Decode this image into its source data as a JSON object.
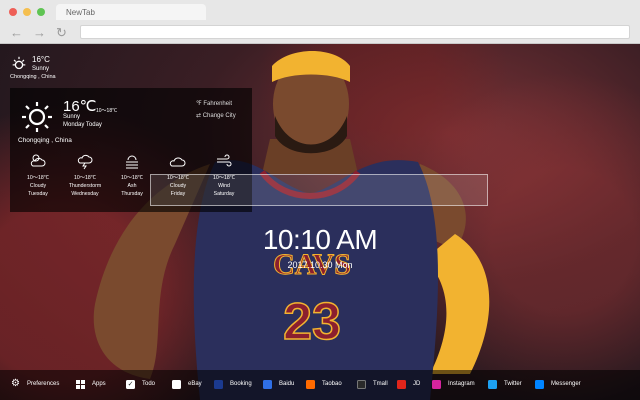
{
  "browser": {
    "tab_title": "NewTab"
  },
  "weather_small": {
    "temp": "16°C",
    "condition": "Sunny",
    "location": "Chongqing , China"
  },
  "weather_panel": {
    "temp": "16℃",
    "range": "10～18℃",
    "condition": "Sunny",
    "day": "Monday Today",
    "fahrenheit": "Fahrenheit",
    "change_city": "Change City",
    "location": "Chongqing , China",
    "forecast": [
      {
        "icon": "cloudy-icon",
        "range": "10～18℃",
        "condition": "Cloudy",
        "day": "Tuesday"
      },
      {
        "icon": "thunderstorm-icon",
        "range": "10～18℃",
        "condition": "Thunderstorm",
        "day": "Wednesday"
      },
      {
        "icon": "ash-icon",
        "range": "10～18℃",
        "condition": "Ash",
        "day": "Thursday"
      },
      {
        "icon": "cloud-icon",
        "range": "10～18℃",
        "condition": "Cloudy",
        "day": "Friday"
      },
      {
        "icon": "wind-icon",
        "range": "10～18℃",
        "condition": "Wind",
        "day": "Saturday"
      }
    ]
  },
  "clock": {
    "time": "10:10 AM",
    "date": "2017.10.30 Mon"
  },
  "bottom_bar": {
    "preferences": "Preferences",
    "apps": "Apps",
    "todo": "Todo",
    "links": [
      "eBay",
      "Booking",
      "Baidu",
      "Taobao",
      "Tmall",
      "JD",
      "Instagram",
      "Twitter",
      "Messenger"
    ]
  },
  "colors": {
    "traffic_red": "#ee5f57",
    "traffic_yellow": "#f5bf4f",
    "traffic_green": "#5fc453",
    "jersey_navy": "#2b2f5c",
    "jersey_wine": "#8b1f2e",
    "jersey_gold": "#f2b330",
    "ebay": "#ffffff",
    "booking": "#1b3a8f",
    "baidu": "#2f6fe6",
    "taobao": "#ff6a00",
    "tmall": "#2a2a2a",
    "jd": "#e1251b",
    "instagram": "#d6249f",
    "twitter": "#1da1f2",
    "messenger": "#0084ff"
  }
}
